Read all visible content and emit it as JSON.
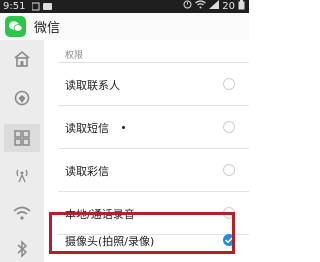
{
  "status_bar": {
    "time": "9:51",
    "signal_text": "20",
    "icons": [
      "notification-icon",
      "alarm-icon",
      "wifi-icon",
      "signal-icon",
      "battery-icon"
    ]
  },
  "app": {
    "title": "微信",
    "icon": "wechat-icon",
    "brand_color": "#2fc54a"
  },
  "sidebar": {
    "items": [
      {
        "icon": "home-icon",
        "active": false
      },
      {
        "icon": "location-icon",
        "active": false
      },
      {
        "icon": "apps-grid-icon",
        "active": true
      },
      {
        "icon": "broadcast-icon",
        "active": false
      },
      {
        "icon": "wifi-icon",
        "active": false
      },
      {
        "icon": "bluetooth-icon",
        "active": false
      }
    ]
  },
  "permissions": {
    "section_title": "权限",
    "items": [
      {
        "label": "读取联系人",
        "checked": false
      },
      {
        "label": "读取短信",
        "checked": false
      },
      {
        "label": "读取彩信",
        "checked": false
      },
      {
        "label": "本地/通话录音",
        "checked": false
      },
      {
        "label": "摄像头(拍照/录像)",
        "checked": true
      }
    ],
    "highlight_color": "#b52028",
    "check_color": "#1a8fe3"
  }
}
